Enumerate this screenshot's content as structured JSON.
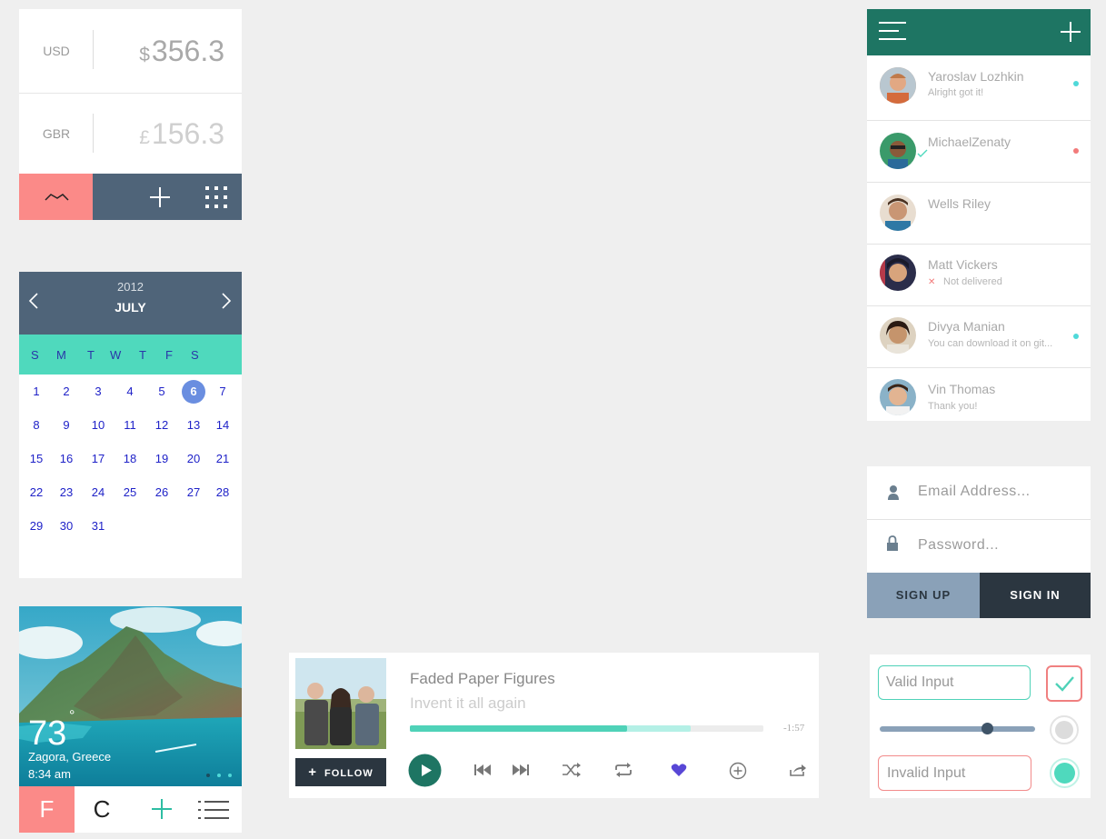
{
  "currency": {
    "rows": [
      {
        "code": "USD",
        "symbol": "$",
        "amount": "356.3"
      },
      {
        "code": "GBR",
        "symbol": "£",
        "amount": "156.3"
      }
    ],
    "icons": [
      "trend-icon",
      "plus-icon",
      "grid-icon"
    ],
    "colors": {
      "accent": "#fb8a88",
      "bar": "#4f6479"
    }
  },
  "calendar": {
    "year": "2012",
    "month": "JULY",
    "day_names": [
      "S",
      "M",
      "T",
      "W",
      "T",
      "F",
      "S"
    ],
    "selected_day": "6",
    "weeks": [
      [
        "1",
        "2",
        "3",
        "4",
        "5",
        "6",
        "7"
      ],
      [
        "8",
        "9",
        "10",
        "11",
        "12",
        "13",
        "14"
      ],
      [
        "15",
        "16",
        "17",
        "18",
        "19",
        "20",
        "21"
      ],
      [
        "22",
        "23",
        "24",
        "25",
        "26",
        "27",
        "28"
      ],
      [
        "29",
        "30",
        "31"
      ]
    ]
  },
  "weather": {
    "temperature": "73",
    "degree": "°",
    "location": "Zagora, Greece",
    "time": "8:34 am",
    "unit_f": "F",
    "unit_c": "C",
    "icons": [
      "plus-icon",
      "list-icon"
    ]
  },
  "player": {
    "title": "Faded Paper Figures",
    "subtitle": "Invent it all again",
    "follow_label": "FOLLOW",
    "time_remaining": "-1:57",
    "progress": 0.615,
    "buffered": 0.795,
    "controls": [
      "play-icon",
      "previous-icon",
      "next-icon",
      "shuffle-icon",
      "repeat-icon",
      "heart-icon",
      "add-icon",
      "share-icon"
    ]
  },
  "contacts": {
    "items": [
      {
        "name": "Yaroslav Lozhkin",
        "message": "Alright got it!",
        "status_color": "#4fd9d9"
      },
      {
        "name": "MichaelZenaty",
        "message": "",
        "status_color": "#f27a7a"
      },
      {
        "name": "Wells Riley",
        "message": "",
        "status_color": ""
      },
      {
        "name": "Matt Vickers",
        "message": "Not delivered",
        "status_color": ""
      },
      {
        "name": "Divya Manian",
        "message": "You can download it on git...",
        "status_color": "#4fd9d9"
      },
      {
        "name": "Vin Thomas",
        "message": "Thank you!",
        "status_color": ""
      }
    ]
  },
  "login": {
    "email_placeholder": "Email Address...",
    "password_placeholder": "Password...",
    "signup_label": "SIGN UP",
    "signin_label": "SIGN IN"
  },
  "forms": {
    "valid_value": "Valid Input",
    "invalid_value": "Invalid Input",
    "slider_value": 0.69,
    "checkbox_checked": true
  }
}
